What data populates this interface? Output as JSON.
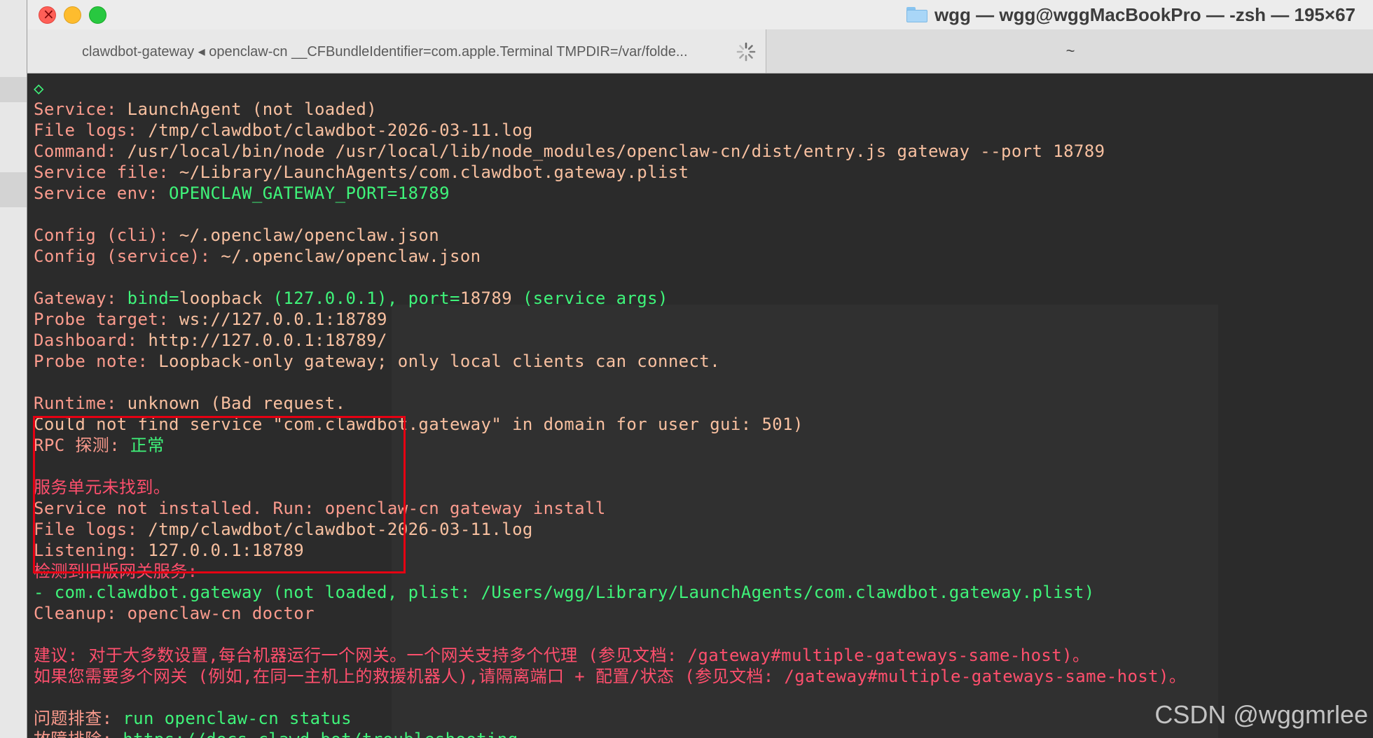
{
  "window": {
    "title": "wgg — wgg@wggMacBookPro — -zsh — 195×67"
  },
  "tabs": [
    {
      "label": "clawdbot-gateway ◂ openclaw-cn __CFBundleIdentifier=com.apple.Terminal TMPDIR=/var/folde...",
      "active": true
    },
    {
      "label": "~",
      "active": false
    }
  ],
  "terminal": {
    "lines": [
      [
        {
          "t": "◇",
          "c": "green"
        }
      ],
      [
        {
          "t": "Service: ",
          "c": "salmon"
        },
        {
          "t": "LaunchAgent (not loaded)",
          "c": "bright"
        }
      ],
      [
        {
          "t": "File logs: ",
          "c": "salmon"
        },
        {
          "t": "/tmp/clawdbot/clawdbot-2026-03-11.log",
          "c": "bright"
        }
      ],
      [
        {
          "t": "Command: ",
          "c": "salmon"
        },
        {
          "t": "/usr/local/bin/node /usr/local/lib/node_modules/openclaw-cn/dist/entry.js gateway --port 18789",
          "c": "bright"
        }
      ],
      [
        {
          "t": "Service file: ",
          "c": "salmon"
        },
        {
          "t": "~/Library/LaunchAgents/com.clawdbot.gateway.plist",
          "c": "bright"
        }
      ],
      [
        {
          "t": "Service env: ",
          "c": "salmon"
        },
        {
          "t": "OPENCLAW_GATEWAY_PORT=18789",
          "c": "green"
        }
      ],
      [],
      [
        {
          "t": "Config (cli): ",
          "c": "salmon"
        },
        {
          "t": "~/.openclaw/openclaw.json",
          "c": "bright"
        }
      ],
      [
        {
          "t": "Config (service): ",
          "c": "salmon"
        },
        {
          "t": "~/.openclaw/openclaw.json",
          "c": "bright"
        }
      ],
      [],
      [
        {
          "t": "Gateway: ",
          "c": "salmon"
        },
        {
          "t": "bind=",
          "c": "green"
        },
        {
          "t": "loopback",
          "c": "bright"
        },
        {
          "t": " (127.0.0.1), ",
          "c": "green"
        },
        {
          "t": "port=",
          "c": "green"
        },
        {
          "t": "18789",
          "c": "bright"
        },
        {
          "t": " (service args)",
          "c": "green"
        }
      ],
      [
        {
          "t": "Probe target: ",
          "c": "salmon"
        },
        {
          "t": "ws://127.0.0.1:18789",
          "c": "bright"
        }
      ],
      [
        {
          "t": "Dashboard: ",
          "c": "salmon"
        },
        {
          "t": "http://127.0.0.1:18789/",
          "c": "bright"
        }
      ],
      [
        {
          "t": "Probe note: ",
          "c": "salmon"
        },
        {
          "t": "Loopback-only gateway; only local clients can connect.",
          "c": "bright"
        }
      ],
      [],
      [
        {
          "t": "Runtime: ",
          "c": "salmon"
        },
        {
          "t": "unknown (Bad request.",
          "c": "bright"
        }
      ],
      [
        {
          "t": "Could not find service \"com.clawdbot.gateway\" in domain for user gui: 501)",
          "c": "bright"
        }
      ],
      [
        {
          "t": "RPC 探测: ",
          "c": "salmon"
        },
        {
          "t": "正常",
          "c": "green"
        }
      ],
      [],
      [
        {
          "t": "服务单元未找到。",
          "c": "red"
        }
      ],
      [
        {
          "t": "Service not installed. Run: openclaw-cn gateway install",
          "c": "salmon"
        }
      ],
      [
        {
          "t": "File logs: ",
          "c": "salmon"
        },
        {
          "t": "/tmp/clawdbot/clawdbot-2026-03-11.log",
          "c": "bright"
        }
      ],
      [
        {
          "t": "Listening: ",
          "c": "salmon"
        },
        {
          "t": "127.0.0.1:18789",
          "c": "bright"
        }
      ],
      [
        {
          "t": "检测到旧版网关服务:",
          "c": "red"
        }
      ],
      [
        {
          "t": "- com.clawdbot.gateway (not loaded, plist: /Users/wgg/Library/LaunchAgents/com.clawdbot.gateway.plist)",
          "c": "green"
        }
      ],
      [
        {
          "t": "Cleanup: openclaw-cn doctor",
          "c": "salmon"
        }
      ],
      [],
      [
        {
          "t": "建议: 对于大多数设置,每台机器运行一个网关。一个网关支持多个代理 (参见文档: /gateway#multiple-gateways-same-host)。",
          "c": "red"
        }
      ],
      [
        {
          "t": "如果您需要多个网关 (例如,在同一主机上的救援机器人),请隔离端口 + 配置/状态 (参见文档: /gateway#multiple-gateways-same-host)。",
          "c": "red"
        }
      ],
      [],
      [
        {
          "t": "问题排查: ",
          "c": "salmon"
        },
        {
          "t": "run openclaw-cn status",
          "c": "green"
        }
      ],
      [
        {
          "t": "故障排除: ",
          "c": "salmon"
        },
        {
          "t": "https://docs.clawd.bot/troubleshooting",
          "c": "green"
        }
      ]
    ]
  },
  "watermark": "CSDN @wggmrlee"
}
